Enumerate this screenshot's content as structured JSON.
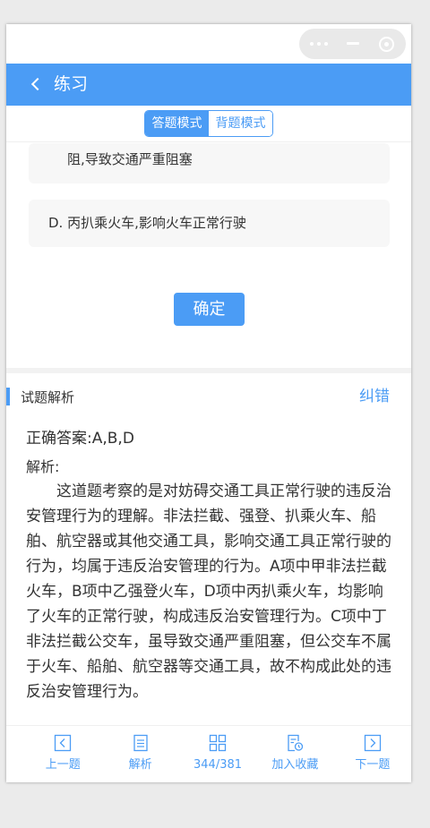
{
  "nav": {
    "title": "练习"
  },
  "mode": {
    "answer_label": "答题模式",
    "recite_label": "背题模式",
    "active": "答题模式"
  },
  "options": {
    "c_tail": "阻,导致交通严重阻塞",
    "d": "D. 丙扒乘火车,影响火车正常行驶"
  },
  "confirm_label": "确定",
  "analysis": {
    "heading": "试题解析",
    "report_label": "纠错",
    "answer_prefix": "正确答案:",
    "answer_value": "A,B,D",
    "label": "解析:",
    "text": "这道题考察的是对妨碍交通工具正常行驶的违反治安管理行为的理解。非法拦截、强登、扒乘火车、船舶、航空器或其他交通工具，影响交通工具正常行驶的行为，均属于违反治安管理的行为。A项中甲非法拦截火车，B项中乙强登火车，D项中丙扒乘火车，均影响了火车的正常行驶，构成违反治安管理行为。C项中丁非法拦截公交车，虽导致交通严重阻塞，但公交车不属于火车、船舶、航空器等交通工具，故不构成此处的违反治安管理行为。"
  },
  "bottom_bar": {
    "prev": {
      "label": "上一题",
      "icon": "chevron-left-square-icon"
    },
    "analysis": {
      "label": "解析",
      "icon": "document-icon"
    },
    "progress": {
      "label": "344/381",
      "current": 344,
      "total": 381,
      "icon": "grid-icon"
    },
    "favorite": {
      "label": "加入收藏",
      "icon": "bookmark-clock-icon"
    },
    "next": {
      "label": "下一题",
      "icon": "chevron-right-square-icon"
    }
  },
  "colors": {
    "accent": "#4b9cf5",
    "card": "#f7f7f7",
    "text": "#333333"
  }
}
